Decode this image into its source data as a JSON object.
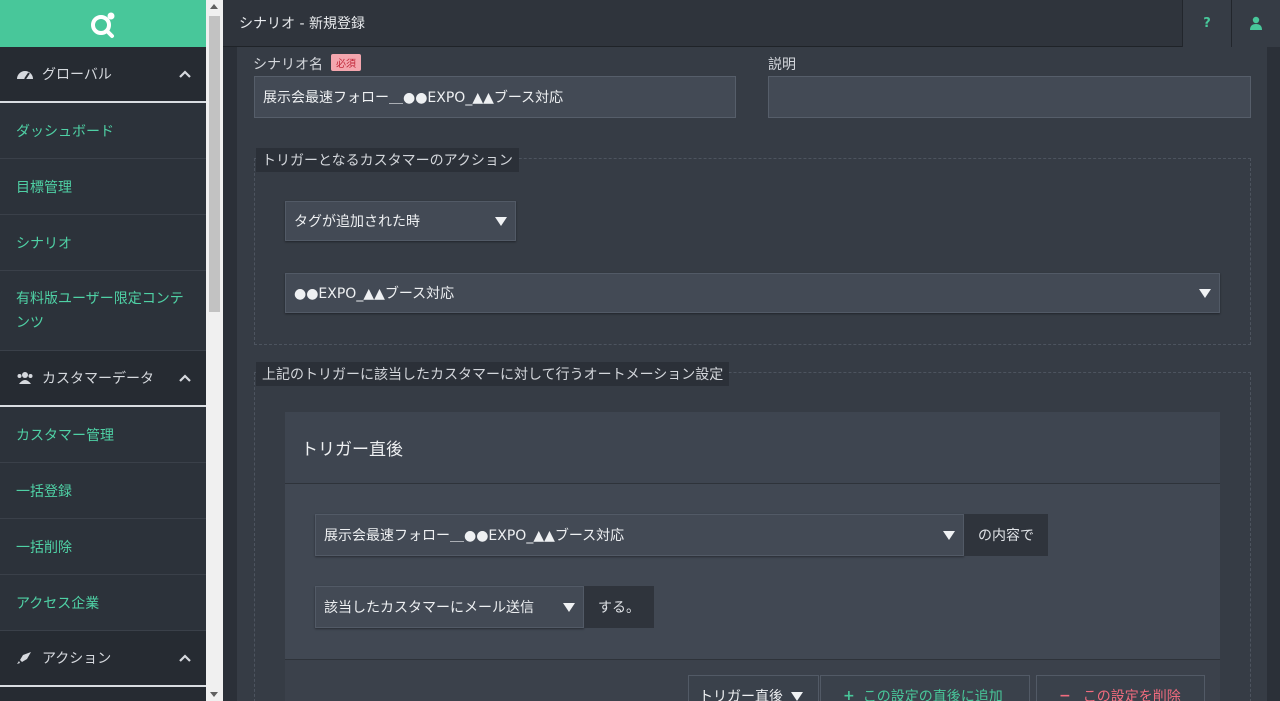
{
  "sidebar": {
    "sections": [
      {
        "label": "グローバル",
        "icon": "dashboard-gauge-icon"
      },
      {
        "label": "カスタマーデータ",
        "icon": "users-icon"
      },
      {
        "label": "アクション",
        "icon": "rocket-icon"
      }
    ],
    "items": [
      {
        "label": "ダッシュボード"
      },
      {
        "label": "目標管理"
      },
      {
        "label": "シナリオ"
      },
      {
        "label": "有料版ユーザー限定コンテンツ"
      },
      {
        "label": "カスタマー管理"
      },
      {
        "label": "一括登録"
      },
      {
        "label": "一括削除"
      },
      {
        "label": "アクセス企業"
      }
    ]
  },
  "header": {
    "title": "シナリオ - 新規登録",
    "help_label": "?",
    "user_icon": "user-icon"
  },
  "form": {
    "scenario_name_label": "シナリオ名",
    "required_badge": "必須",
    "scenario_name_value": "展示会最速フォロー＿●●EXPO_▲▲ブース対応",
    "description_label": "説明",
    "description_value": ""
  },
  "trigger": {
    "legend": "トリガーとなるカスタマーのアクション",
    "type_value": "タグが追加された時",
    "tag_value": "●●EXPO_▲▲ブース対応"
  },
  "automation": {
    "legend": "上記のトリガーに該当したカスタマーに対して行うオートメーション設定",
    "box_title": "トリガー直後",
    "content_value": "展示会最速フォロー＿●●EXPO_▲▲ブース対応",
    "content_suffix": "の内容で",
    "action_value": "該当したカスタマーにメール送信",
    "action_suffix": "する。",
    "timing_value": "トリガー直後",
    "add_label": "この設定の直後に追加",
    "delete_label": "この設定を削除"
  },
  "colors": {
    "accent": "#48c79a",
    "danger": "#f06b7e"
  }
}
